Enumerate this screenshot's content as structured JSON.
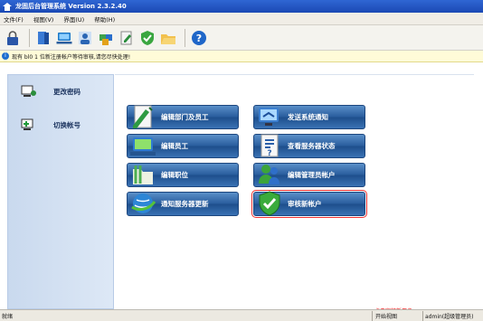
{
  "window": {
    "title": "龙固后台管理系统 Version 2.3.2.40"
  },
  "menu": {
    "items": [
      "文件(F)",
      "视图(V)",
      "界面(U)",
      "帮助(H)"
    ]
  },
  "notice": {
    "text": "现有 bl0 1 位新注册帐户等待审核,请您尽快处理!"
  },
  "sidebar": {
    "items": [
      {
        "label": "更改密码"
      },
      {
        "label": "切换帐号"
      }
    ]
  },
  "buttons": [
    {
      "label": "编辑部门及员工"
    },
    {
      "label": "发送系统通知"
    },
    {
      "label": "编辑员工"
    },
    {
      "label": "查看服务器状态"
    },
    {
      "label": "编辑职位"
    },
    {
      "label": "编辑管理员帐户"
    },
    {
      "label": "通知服务器更新"
    },
    {
      "label": "审核新帐户"
    }
  ],
  "hint": {
    "text": "点击审核新用户"
  },
  "status": {
    "left": "就绪",
    "middle": "开始视图",
    "right": "admin(超级管理员)"
  }
}
